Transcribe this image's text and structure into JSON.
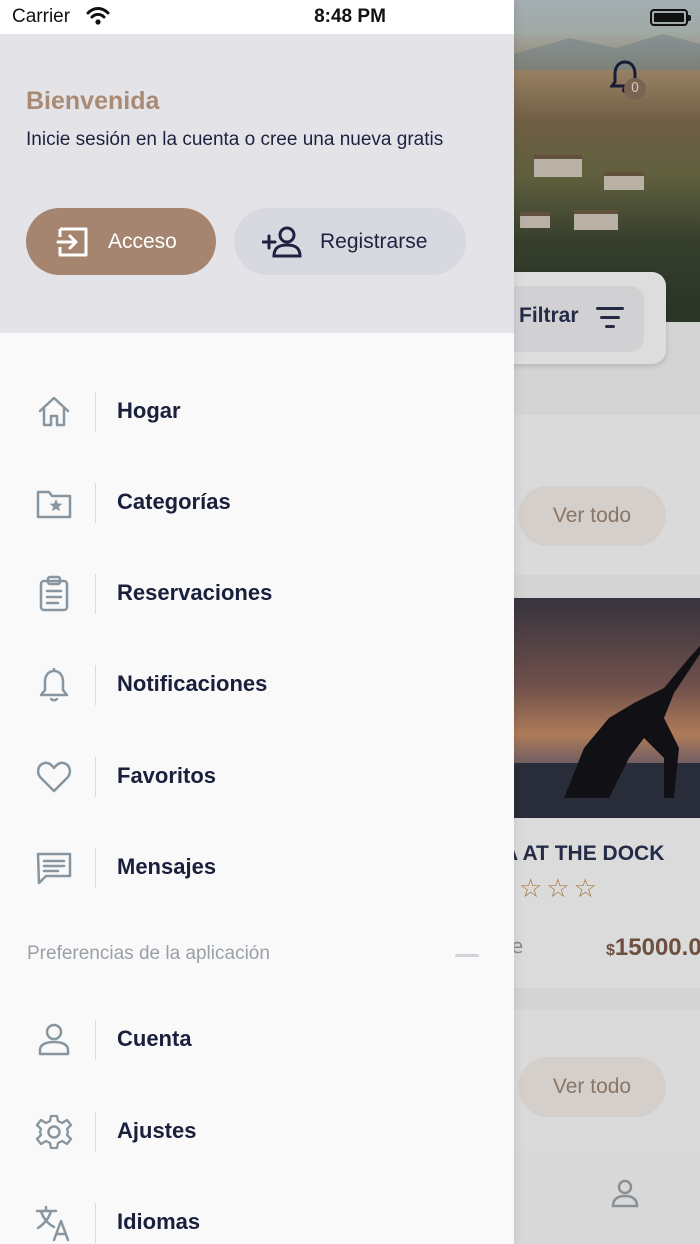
{
  "status_bar": {
    "carrier": "Carrier",
    "time": "8:48 PM"
  },
  "drawer": {
    "title": "Bienvenida",
    "subtitle": "Inicie sesión en la cuenta o cree una nueva gratis",
    "login_label": "Acceso",
    "register_label": "Registrarse",
    "menu": [
      {
        "label": "Hogar",
        "icon": "home-icon"
      },
      {
        "label": "Categorías",
        "icon": "folder-star-icon"
      },
      {
        "label": "Reservaciones",
        "icon": "clipboard-icon"
      },
      {
        "label": "Notificaciones",
        "icon": "bell-icon"
      },
      {
        "label": "Favoritos",
        "icon": "heart-icon"
      },
      {
        "label": "Mensajes",
        "icon": "message-icon"
      }
    ],
    "preferences_title": "Preferencias de la aplicación",
    "preferences": [
      {
        "label": "Cuenta",
        "icon": "user-icon"
      },
      {
        "label": "Ajustes",
        "icon": "gear-icon"
      },
      {
        "label": "Idiomas",
        "icon": "translate-icon"
      }
    ]
  },
  "background": {
    "notification_count": "0",
    "filter_label": "Filtrar",
    "view_all_label": "Ver todo",
    "card_title": "A AT THE DOCK",
    "card_stars": "☆☆☆",
    "card_price_currency": "$",
    "card_price": "15000.0",
    "card_cut_text": "e"
  },
  "colors": {
    "accent": "#a68570",
    "title": "#a98a75",
    "text": "#1a1f3c",
    "icon": "#8796a0"
  }
}
